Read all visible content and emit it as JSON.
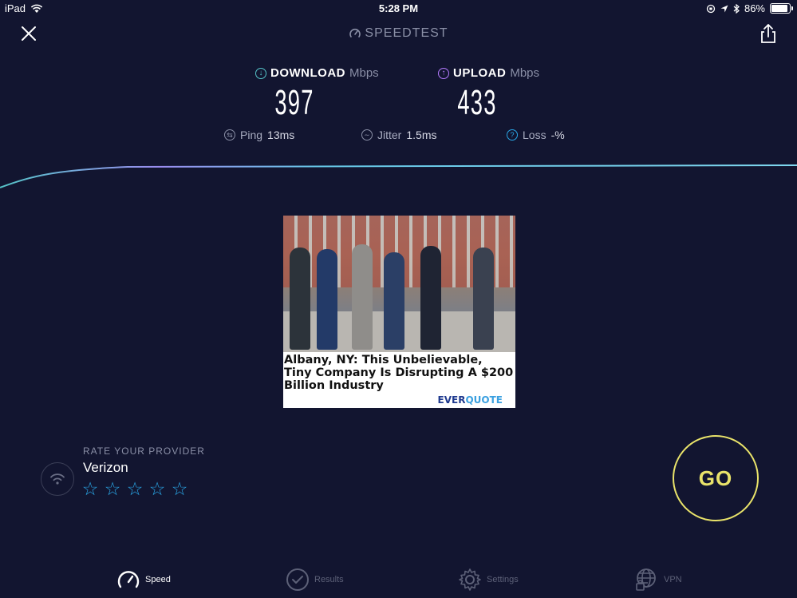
{
  "status_bar": {
    "device": "iPad",
    "time": "5:28 PM",
    "battery": "86%",
    "battery_level": 0.86
  },
  "header": {
    "title": "SPEEDTEST",
    "close_icon": "close-icon",
    "share_icon": "share-icon"
  },
  "metrics": {
    "download": {
      "label": "DOWNLOAD",
      "unit": "Mbps",
      "value": "397",
      "color": "#55c4c8"
    },
    "upload": {
      "label": "UPLOAD",
      "unit": "Mbps",
      "value": "433",
      "color": "#b57bff"
    },
    "ping": {
      "label": "Ping",
      "value": "13",
      "unit": "ms"
    },
    "jitter": {
      "label": "Jitter",
      "value": "1.5",
      "unit": "ms"
    },
    "loss": {
      "label": "Loss",
      "value": "-",
      "unit": "%"
    }
  },
  "ad": {
    "headline": "Albany, NY: This Unbelievable, Tiny Company Is Disrupting A $200 Billion Industry",
    "logo_a": "EVER",
    "logo_b": "QUOTE"
  },
  "provider": {
    "rate_label": "RATE YOUR PROVIDER",
    "name": "Verizon",
    "rating": 0,
    "max_rating": 5
  },
  "go_button": "GO",
  "colors": {
    "background": "#121530",
    "accent_go": "#e9e36a",
    "star": "#2aa8e8"
  },
  "tabs": [
    {
      "label": "Speed",
      "icon": "speedometer-icon",
      "active": true
    },
    {
      "label": "Results",
      "icon": "check-circle-icon",
      "active": false
    },
    {
      "label": "Settings",
      "icon": "gear-icon",
      "active": false
    },
    {
      "label": "VPN",
      "icon": "globe-lock-icon",
      "active": false
    }
  ]
}
